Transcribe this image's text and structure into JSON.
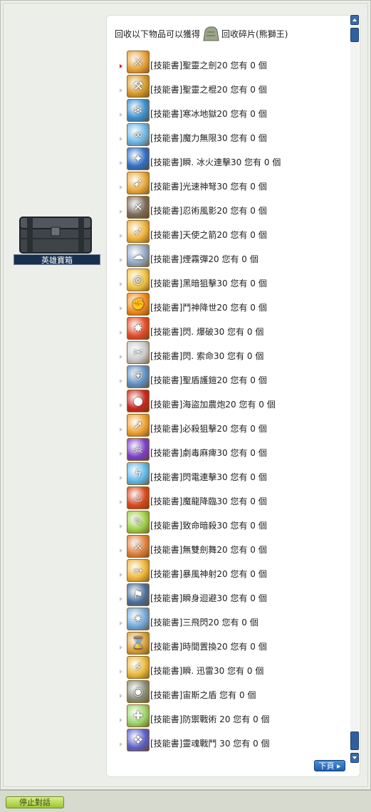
{
  "npc": {
    "name": "英雄寶箱"
  },
  "header": {
    "prefix": "回收以下物品可以獲得",
    "suffix": "回收碎片(熊獅王)"
  },
  "items": [
    {
      "label": "[技能書]聖靈之劍20  您有  0  個",
      "icon": "sword-skill-icon",
      "color": "#e8a23a",
      "glyph": "⚔",
      "selected": true
    },
    {
      "label": "[技能書]聖靈之棍20  您有  0  個",
      "icon": "mace-skill-icon",
      "color": "#d69b2e",
      "glyph": "⚒"
    },
    {
      "label": "[技能書]寒冰地獄20  您有  0  個",
      "icon": "ice-skill-icon",
      "color": "#3b8fd0",
      "glyph": "❄"
    },
    {
      "label": "[技能書]魔力無限30  您有  0  個",
      "icon": "infinity-skill-icon",
      "color": "#6db6e6",
      "glyph": "∞"
    },
    {
      "label": "[技能書]瞬. 冰火連擊30  您有  0  個",
      "icon": "fire-ice-skill-icon",
      "color": "#2e6fc8",
      "glyph": "✦"
    },
    {
      "label": "[技能書]光速神弩30  您有  0  個",
      "icon": "crossbow-skill-icon",
      "color": "#e9a93b",
      "glyph": "➹"
    },
    {
      "label": "[技能書]忍術風影20  您有  0  個",
      "icon": "shadow-skill-icon",
      "color": "#7a6b5a",
      "glyph": "✕"
    },
    {
      "label": "[技能書]天使之箭20  您有  0  個",
      "icon": "angel-arrow-skill-icon",
      "color": "#f0b13a",
      "glyph": "➶"
    },
    {
      "label": "[技能書]煙霧彈20  您有  0  個",
      "icon": "smoke-bomb-skill-icon",
      "color": "#8fa6c6",
      "glyph": "☁"
    },
    {
      "label": "[技能書]黑暗狙擊30  您有  0  個",
      "icon": "dark-snipe-skill-icon",
      "color": "#f2c342",
      "glyph": "◎"
    },
    {
      "label": "[技能書]鬥神降世20  您有  0  個",
      "icon": "war-god-skill-icon",
      "color": "#f08a1e",
      "glyph": "✊"
    },
    {
      "label": "[技能書]閃. 爆破30  您有  0  個",
      "icon": "explosion-skill-icon",
      "color": "#e34b2a",
      "glyph": "✸"
    },
    {
      "label": "[技能書]閃. 索命30  您有  0  個",
      "icon": "reaper-skill-icon",
      "color": "#c9c9c9",
      "glyph": "✂"
    },
    {
      "label": "[技能書]聖盾護鎧20  您有  0  個",
      "icon": "holy-shield-skill-icon",
      "color": "#5b8fc4",
      "glyph": "⛨"
    },
    {
      "label": "[技能書]海盜加農炮20  您有  0  個",
      "icon": "cannon-skill-icon",
      "color": "#c8281e",
      "glyph": "●"
    },
    {
      "label": "[技能書]必殺狙擊20  您有  0  個",
      "icon": "snipe-skill-icon",
      "color": "#f0a030",
      "glyph": "➚"
    },
    {
      "label": "[技能書]劇毒麻痺30  您有  0  個",
      "icon": "poison-skill-icon",
      "color": "#7b3fc9",
      "glyph": "☠"
    },
    {
      "label": "[技能書]閃電連擊30  您有  0  個",
      "icon": "lightning-skill-icon",
      "color": "#5fb8ea",
      "glyph": "ϟ"
    },
    {
      "label": "[技能書]魔龍降臨30  您有  0  個",
      "icon": "dragon-skill-icon",
      "color": "#d9481f",
      "glyph": "♨"
    },
    {
      "label": "[技能書]致命暗殺30  您有  0  個",
      "icon": "assassinate-skill-icon",
      "color": "#9ed04a",
      "glyph": "✎"
    },
    {
      "label": "[技能書]無雙劍舞20  您有  0  個",
      "icon": "sword-dance-skill-icon",
      "color": "#e0803a",
      "glyph": "⚔"
    },
    {
      "label": "[技能書]暴風神射20  您有  0  個",
      "icon": "storm-shot-skill-icon",
      "color": "#f0b53a",
      "glyph": "➳"
    },
    {
      "label": "[技能書]瞬身迴避30  您有  0  個",
      "icon": "evade-skill-icon",
      "color": "#4a6f9a",
      "glyph": "⚑"
    },
    {
      "label": "[技能書]三飛閃20  您有  0  個",
      "icon": "triple-throw-skill-icon",
      "color": "#6fa8dc",
      "glyph": "✷"
    },
    {
      "label": "[技能書]時間置換20  您有  0  個",
      "icon": "time-skill-icon",
      "color": "#d9a13a",
      "glyph": "⌛"
    },
    {
      "label": "[技能書]瞬. 迅雷30  您有  0  個",
      "icon": "thunder-skill-icon",
      "color": "#e8b83a",
      "glyph": "⚡"
    },
    {
      "label": "[技能書]宙斯之盾  您有  0  個",
      "icon": "zeus-shield-skill-icon",
      "color": "#8a8f7a",
      "glyph": "◉"
    },
    {
      "label": "[技能書]防禦戰術 20  您有  0  個",
      "icon": "defense-tactics-skill-icon",
      "color": "#9bd36a",
      "glyph": "✚"
    },
    {
      "label": "[技能書]靈魂戰鬥 30  您有  0  個",
      "icon": "soul-battle-skill-icon",
      "color": "#5b5fc8",
      "glyph": "❖"
    }
  ],
  "buttons": {
    "next": "下頁 ▸",
    "end_chat": "停止對話"
  }
}
